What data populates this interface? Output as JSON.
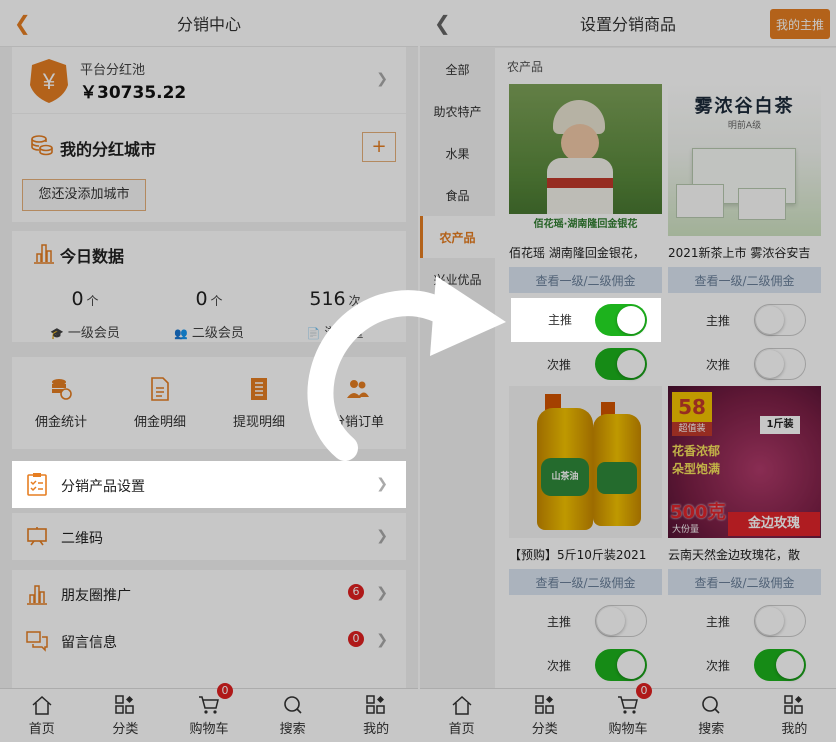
{
  "left": {
    "title": "分销中心",
    "pool": {
      "label": "平台分红池",
      "amount": "￥30735.22",
      "yen_glyph": "¥"
    },
    "city": {
      "title": "我的分红城市",
      "add_symbol": "+",
      "empty_button": "您还没添加城市"
    },
    "today": {
      "title": "今日数据",
      "stats": [
        {
          "value": "0",
          "unit": "个",
          "label": "一级会员"
        },
        {
          "value": "0",
          "unit": "个",
          "label": "二级会员"
        },
        {
          "value": "516",
          "unit": "次",
          "label": "浏览量"
        }
      ]
    },
    "grid": [
      "佣金统计",
      "佣金明细",
      "提现明细",
      "分销订单"
    ],
    "menu1": [
      "分销产品设置",
      "二维码"
    ],
    "menu2": [
      {
        "label": "朋友圈推广",
        "badge": "6"
      },
      {
        "label": "留言信息",
        "badge": "0"
      }
    ],
    "tabs": [
      "首页",
      "分类",
      "购物车",
      "搜索",
      "我的"
    ],
    "cart_badge": "0"
  },
  "right": {
    "title": "设置分销商品",
    "top_button": "我的主推",
    "categories": [
      "全部",
      "助农特产",
      "水果",
      "食品",
      "农产品",
      "兴业优品"
    ],
    "active_category_index": 4,
    "section_label": "农产品",
    "commission_label": "查看一级/二级佣金",
    "main_label": "主推",
    "sub_label": "次推",
    "products": [
      {
        "name": "佰花瑶 湖南隆回金银花，",
        "img_caption": "佰花瑶·湖南隆回金银花",
        "main_on": true,
        "sub_on": true
      },
      {
        "name": "2021新茶上市 雾浓谷安吉",
        "img_caption": "雾浓谷白茶",
        "main_on": false,
        "sub_on": false
      },
      {
        "name": "【预购】5斤10斤装2021",
        "img_caption": "",
        "main_on": false,
        "sub_on": true
      },
      {
        "name": "云南天然金边玫瑰花，散",
        "img_caption": "金边玫瑰",
        "main_on": false,
        "sub_on": true
      }
    ],
    "tabs": [
      "首页",
      "分类",
      "购物车",
      "搜索",
      "我的"
    ],
    "cart_badge": "0",
    "img_texts": {
      "tea_sub": "明前A级",
      "rose_num": "58",
      "rose_deal": "超值装",
      "rose_bag": "1斤装",
      "rose_slogan1": "花香浓郁",
      "rose_slogan2": "朵型饱满",
      "rose_price": "500克",
      "rose_price_sub": "大份量",
      "oil_label": "山茶油"
    }
  },
  "colors": {
    "accent": "#e67e22",
    "toggle_on": "#1db21d",
    "badge": "#e02020"
  }
}
